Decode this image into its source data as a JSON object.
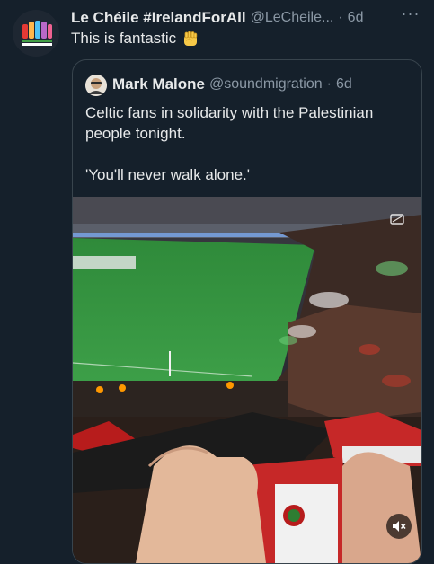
{
  "tweet": {
    "author_name": "Le Chéile #IrelandForAll",
    "author_handle": "@LeCheile...",
    "separator": "·",
    "time": "6d",
    "more_label": "···",
    "text": "This is fantastic"
  },
  "quoted": {
    "author_name": "Mark Malone",
    "author_handle": "@soundmigration",
    "separator": "·",
    "time": "6d",
    "text_line1": "Celtic fans in solidarity with the Palestinian people tonight.",
    "text_line2": "'You'll never walk alone.'"
  },
  "media": {
    "type": "video",
    "icons": [
      "gif-badge-icon",
      "mute-icon"
    ]
  },
  "colors": {
    "background": "#15202b",
    "primary_text": "#e7e9ea",
    "secondary_text": "#8b98a5",
    "border": "#38444d",
    "emoji_fist": "#f7c948"
  }
}
